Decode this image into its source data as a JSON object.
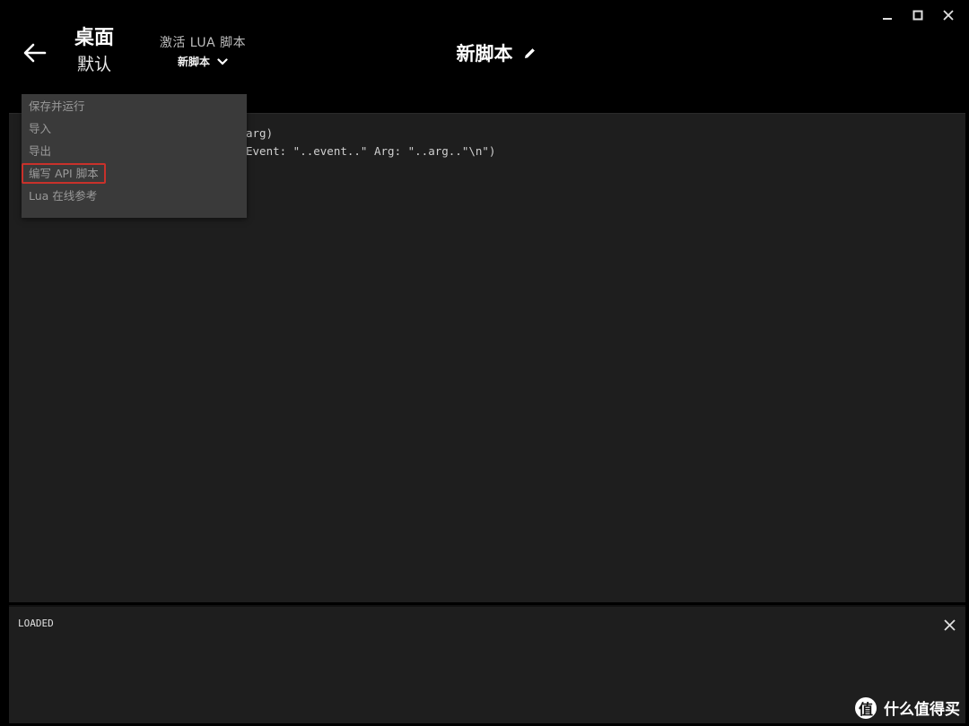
{
  "header": {
    "profile_name": "桌面",
    "profile_sub": "默认",
    "script_select_label": "激活 LUA 脚本",
    "script_select_value": "新脚本",
    "script_title": "新脚本"
  },
  "menu": {
    "items": [
      {
        "label": "保存并运行"
      },
      {
        "label": "导入"
      },
      {
        "label": "导出"
      },
      {
        "label": "编写 API 脚本"
      },
      {
        "label": "Lua 在线参考"
      }
    ]
  },
  "editor": {
    "lines": [
      "arg)",
      "Event: \"..event..\" Arg: \"..arg..\"\\n\")"
    ]
  },
  "output": {
    "text": "LOADED"
  },
  "watermark": {
    "logo": "值",
    "text": "什么值得买"
  },
  "icons": {
    "back": "arrow-left-icon",
    "chevron": "chevron-down-icon",
    "edit": "pencil-icon",
    "close": "close-icon",
    "minimize": "minimize-icon",
    "maximize": "maximize-icon"
  },
  "colors": {
    "highlight_border": "#c8312b",
    "editor_bg": "#1e1e1e",
    "menu_bg": "#3a3a3a"
  }
}
